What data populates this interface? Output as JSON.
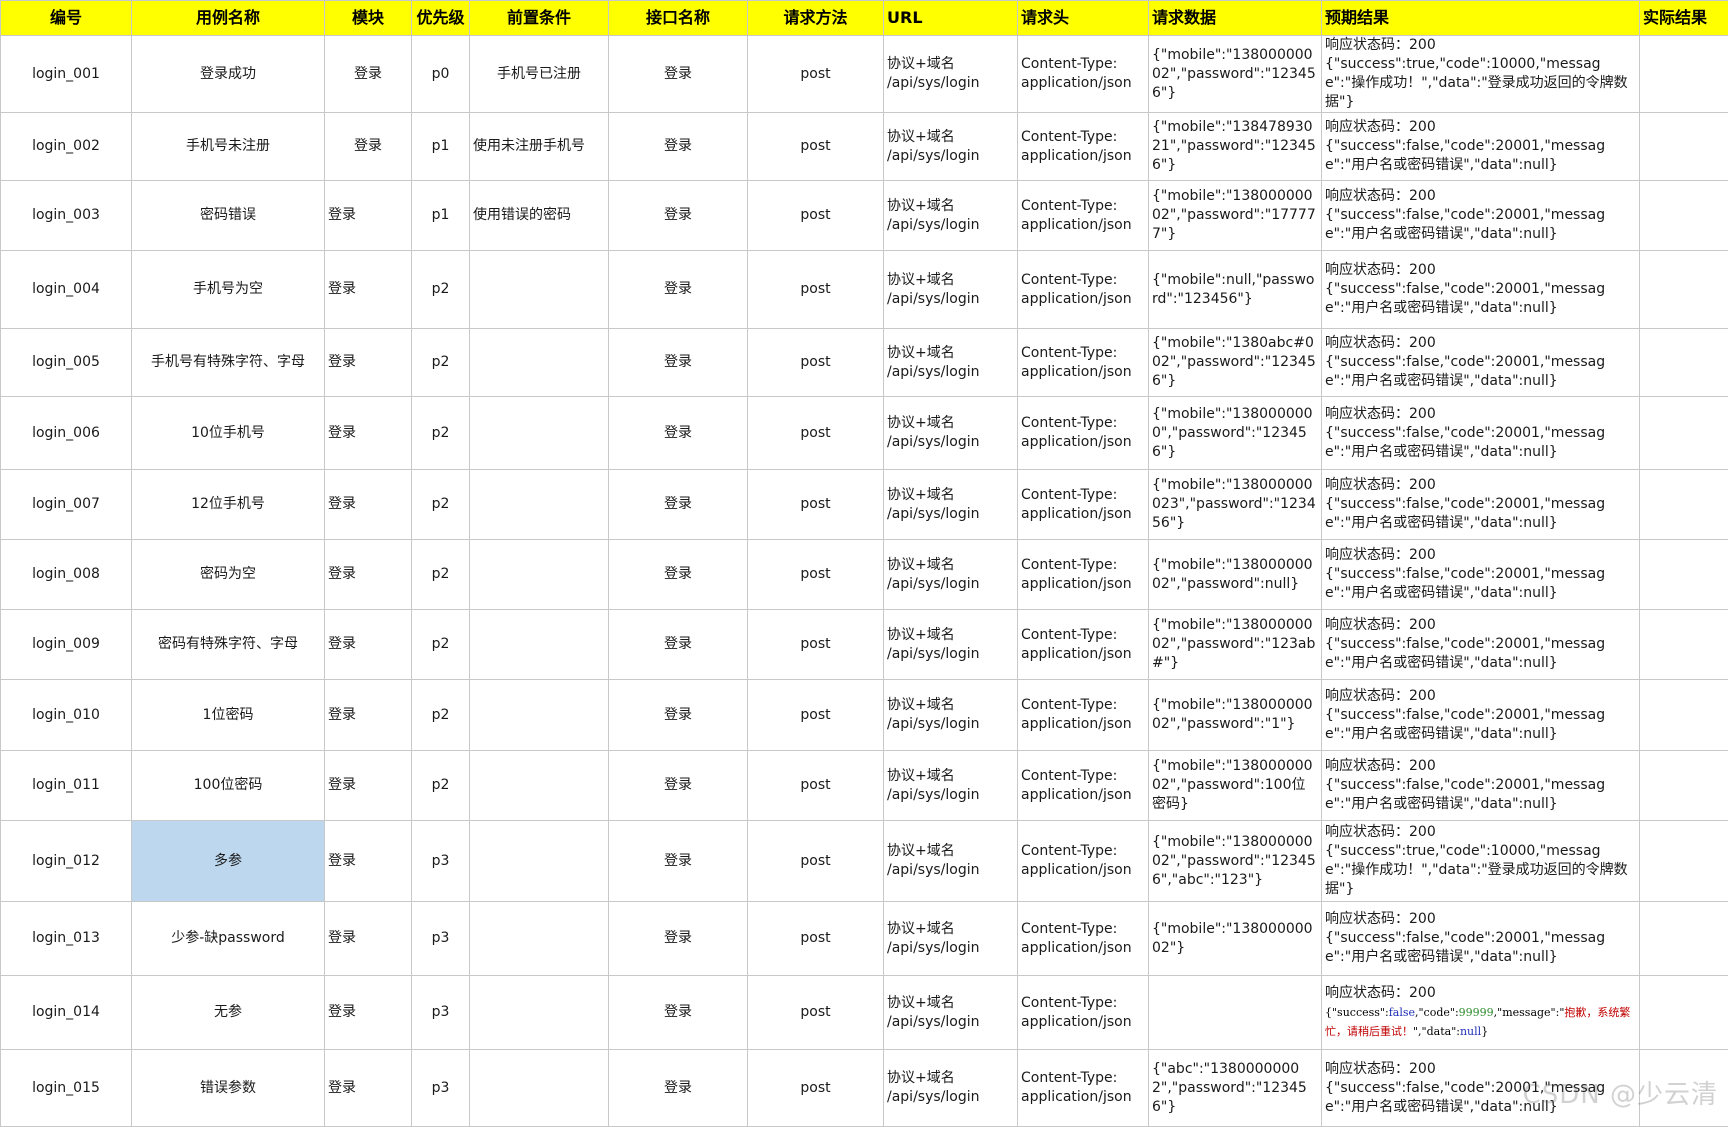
{
  "headers": [
    "编号",
    "用例名称",
    "模块",
    "优先级",
    "前置条件",
    "接口名称",
    "请求方法",
    "URL",
    "请求头",
    "请求数据",
    "预期结果",
    "实际结果"
  ],
  "rows": [
    {
      "id": "login_001",
      "name": "登录成功",
      "module": "登录",
      "priority": "p0",
      "precondition": "手机号已注册",
      "api": "登录",
      "method": "post",
      "url": "协议+域名\n/api/sys/login",
      "header": "Content-Type:\napplication/json",
      "data": "{\"mobile\":\"13800000002\",\"password\":\"123456\"}",
      "expected": "响应状态码：200\n{\"success\":true,\"code\":10000,\"message\":\"操作成功！\",\"data\":\"登录成功返回的令牌数据\"}"
    },
    {
      "id": "login_002",
      "name": "手机号未注册",
      "module": "登录",
      "priority": "p1",
      "precondition": "使用未注册手机号",
      "api": "登录",
      "method": "post",
      "url": "协议+域名\n/api/sys/login",
      "header": "Content-Type:\napplication/json",
      "data": "{\"mobile\":\"13847893021\",\"password\":\"123456\"}",
      "expected": "响应状态码：200\n{\"success\":false,\"code\":20001,\"message\":\"用户名或密码错误\",\"data\":null}"
    },
    {
      "id": "login_003",
      "name": "密码错误",
      "module": "登录",
      "priority": "p1",
      "precondition": "使用错误的密码",
      "api": "登录",
      "method": "post",
      "url": "协议+域名\n/api/sys/login",
      "header": "Content-Type:\napplication/json",
      "data": "{\"mobile\":\"13800000002\",\"password\":\"177777\"}",
      "expected": "响应状态码：200\n{\"success\":false,\"code\":20001,\"message\":\"用户名或密码错误\",\"data\":null}"
    },
    {
      "id": "login_004",
      "name": "手机号为空",
      "module": "登录",
      "priority": "p2",
      "precondition": "",
      "api": "登录",
      "method": "post",
      "url": "协议+域名\n/api/sys/login",
      "header": "Content-Type:\napplication/json",
      "data": "{\"mobile\":null,\"password\":\"123456\"}",
      "expected": "响应状态码：200\n{\"success\":false,\"code\":20001,\"message\":\"用户名或密码错误\",\"data\":null}"
    },
    {
      "id": "login_005",
      "name": "手机号有特殊字符、字母",
      "module": "登录",
      "priority": "p2",
      "precondition": "",
      "api": "登录",
      "method": "post",
      "url": "协议+域名\n/api/sys/login",
      "header": "Content-Type:\napplication/json",
      "data": "{\"mobile\":\"1380abc#002\",\"password\":\"123456\"}",
      "expected": "响应状态码：200\n{\"success\":false,\"code\":20001,\"message\":\"用户名或密码错误\",\"data\":null}"
    },
    {
      "id": "login_006",
      "name": "10位手机号",
      "module": "登录",
      "priority": "p2",
      "precondition": "",
      "api": "登录",
      "method": "post",
      "url": "协议+域名\n/api/sys/login",
      "header": "Content-Type:\napplication/json",
      "data": "{\"mobile\":\"1380000000\",\"password\":\"123456\"}",
      "expected": "响应状态码：200\n{\"success\":false,\"code\":20001,\"message\":\"用户名或密码错误\",\"data\":null}"
    },
    {
      "id": "login_007",
      "name": "12位手机号",
      "module": "登录",
      "priority": "p2",
      "precondition": "",
      "api": "登录",
      "method": "post",
      "url": "协议+域名\n/api/sys/login",
      "header": "Content-Type:\napplication/json",
      "data": "{\"mobile\":\"138000000023\",\"password\":\"123456\"}",
      "expected": "响应状态码：200\n{\"success\":false,\"code\":20001,\"message\":\"用户名或密码错误\",\"data\":null}"
    },
    {
      "id": "login_008",
      "name": "密码为空",
      "module": "登录",
      "priority": "p2",
      "precondition": "",
      "api": "登录",
      "method": "post",
      "url": "协议+域名\n/api/sys/login",
      "header": "Content-Type:\napplication/json",
      "data": "{\"mobile\":\"13800000002\",\"password\":null}",
      "expected": "响应状态码：200\n{\"success\":false,\"code\":20001,\"message\":\"用户名或密码错误\",\"data\":null}"
    },
    {
      "id": "login_009",
      "name": "密码有特殊字符、字母",
      "module": "登录",
      "priority": "p2",
      "precondition": "",
      "api": "登录",
      "method": "post",
      "url": "协议+域名\n/api/sys/login",
      "header": "Content-Type:\napplication/json",
      "data": "{\"mobile\":\"13800000002\",\"password\":\"123ab#\"}",
      "expected": "响应状态码：200\n{\"success\":false,\"code\":20001,\"message\":\"用户名或密码错误\",\"data\":null}"
    },
    {
      "id": "login_010",
      "name": "1位密码",
      "module": "登录",
      "priority": "p2",
      "precondition": "",
      "api": "登录",
      "method": "post",
      "url": "协议+域名\n/api/sys/login",
      "header": "Content-Type:\napplication/json",
      "data": "{\"mobile\":\"13800000002\",\"password\":\"1\"}",
      "expected": "响应状态码：200\n{\"success\":false,\"code\":20001,\"message\":\"用户名或密码错误\",\"data\":null}"
    },
    {
      "id": "login_011",
      "name": "100位密码",
      "module": "登录",
      "priority": "p2",
      "precondition": "",
      "api": "登录",
      "method": "post",
      "url": "协议+域名\n/api/sys/login",
      "header": "Content-Type:\napplication/json",
      "data": "{\"mobile\":\"13800000002\",\"password\":100位密码}",
      "expected": "响应状态码：200\n{\"success\":false,\"code\":20001,\"message\":\"用户名或密码错误\",\"data\":null}"
    },
    {
      "id": "login_012",
      "name": "多参",
      "module": "登录",
      "priority": "p3",
      "precondition": "",
      "api": "登录",
      "method": "post",
      "url": "协议+域名\n/api/sys/login",
      "header": "Content-Type:\napplication/json",
      "data": "{\"mobile\":\"13800000002\",\"password\":\"123456\",\"abc\":\"123\"}",
      "expected": "响应状态码：200\n{\"success\":true,\"code\":10000,\"message\":\"操作成功！\",\"data\":\"登录成功返回的令牌数据\"}"
    },
    {
      "id": "login_013",
      "name": "少参-缺password",
      "module": "登录",
      "priority": "p3",
      "precondition": "",
      "api": "登录",
      "method": "post",
      "url": "协议+域名\n/api/sys/login",
      "header": "Content-Type:\napplication/json",
      "data": "{\"mobile\":\"13800000002\"}",
      "expected": "响应状态码：200\n{\"success\":false,\"code\":20001,\"message\":\"用户名或密码错误\",\"data\":null}"
    },
    {
      "id": "login_014",
      "name": "无参",
      "module": "登录",
      "priority": "p3",
      "precondition": "",
      "api": "登录",
      "method": "post",
      "url": "协议+域名\n/api/sys/login",
      "header": "Content-Type:\napplication/json",
      "data": "",
      "expected_status": "响应状态码：200",
      "expected_json": {
        "open": "{\"success\":",
        "bool": "false",
        "mid1": ",\"code\":",
        "num": "99999",
        "mid2": ",\"message\":\"",
        "msg": "抱歉，系统繁忙，请稍后重试！",
        "tail1": "\",\"data\":",
        "nul": "null",
        "close": "}"
      }
    },
    {
      "id": "login_015",
      "name": "错误参数",
      "module": "登录",
      "priority": "p3",
      "precondition": "",
      "api": "登录",
      "method": "post",
      "url": "协议+域名\n/api/sys/login",
      "header": "Content-Type:\napplication/json",
      "data": "{\"abc\":\"13800000002\",\"password\":\"123456\"}",
      "expected": "响应状态码：200\n{\"success\":false,\"code\":20001,\"message\":\"用户名或密码错误\",\"data\":null}"
    }
  ],
  "watermark": "CSDN @少云清"
}
